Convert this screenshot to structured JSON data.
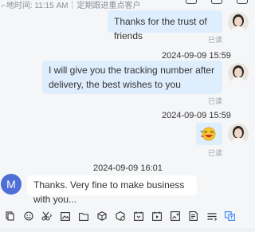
{
  "header": {
    "time_label": "地时间: 11:15 AM",
    "customer_tag": "定期跟进重点客户"
  },
  "messages": [
    {
      "type": "outgoing",
      "text": "Thanks for the trust of friends",
      "status": "已读"
    },
    {
      "type": "timestamp",
      "text": "2024-09-09 15:59"
    },
    {
      "type": "outgoing",
      "text": "I will give you the tracking number after delivery, the best wishes to you",
      "status": "已读"
    },
    {
      "type": "timestamp",
      "text": "2024-09-09 15:59"
    },
    {
      "type": "outgoing-sticker",
      "sticker": "laughing-face-sticker",
      "status": "已读"
    },
    {
      "type": "timestamp",
      "text": "2024-09-09 16:01"
    },
    {
      "type": "incoming",
      "avatar_letter": "M",
      "text": "Thanks. Very fine to make business with you..."
    }
  ],
  "toolbar": {
    "icons": [
      "copy-icon",
      "emoji-icon",
      "scissors-icon",
      "image-icon",
      "folder-icon",
      "package-icon",
      "product-icon",
      "calendar-icon",
      "video-icon",
      "photo-add-icon",
      "quote-icon",
      "quick-reply-icon",
      "translate-icon"
    ]
  },
  "colors": {
    "outgoing_bubble": "#dfeefd",
    "incoming_bubble": "#ffffff",
    "background": "#f5f6f8",
    "avatar_m": "#4f6fd6",
    "toolbar_accent": "#2f7df6"
  }
}
